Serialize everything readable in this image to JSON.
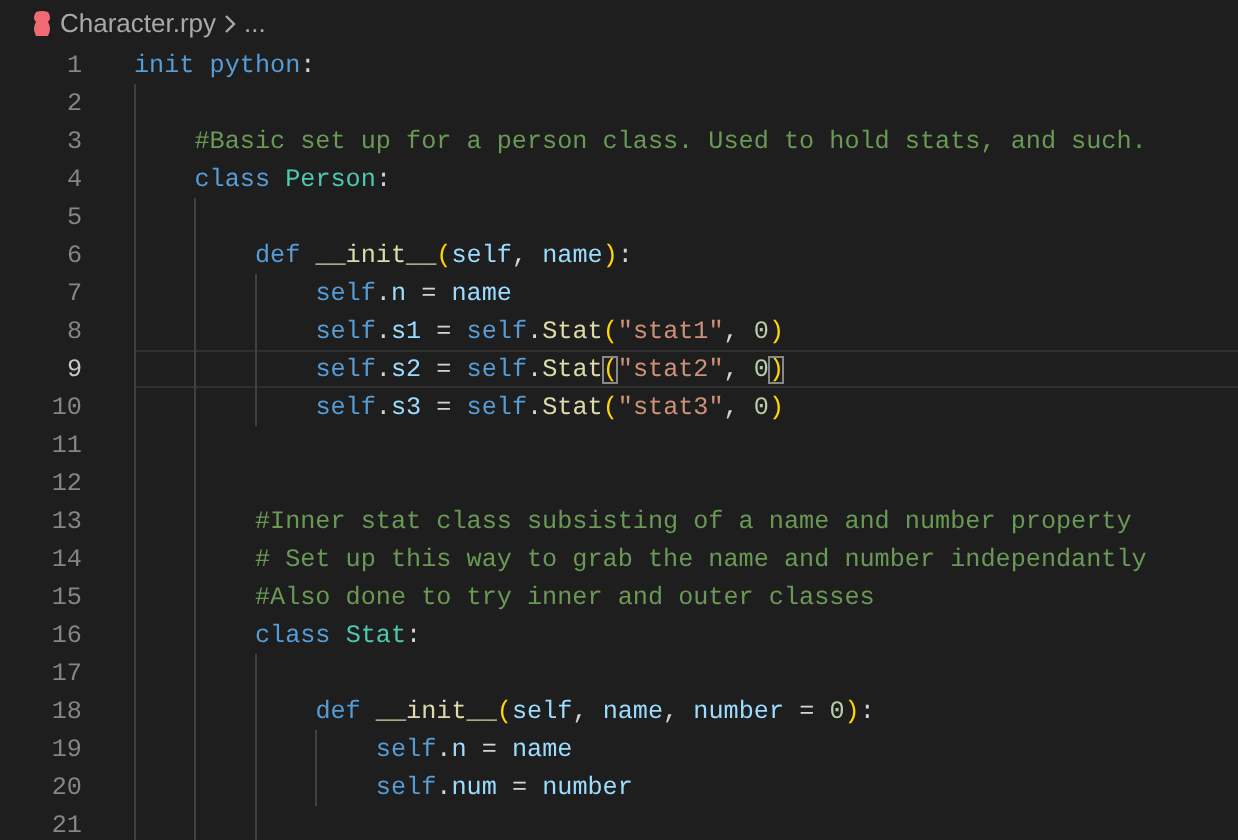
{
  "breadcrumb": {
    "file": "Character.rpy",
    "rest": "..."
  },
  "lines": [
    {
      "number": "1",
      "current": false,
      "tokens": [
        {
          "kind": "keyword",
          "text": "init "
        },
        {
          "kind": "keyword",
          "text": "python"
        },
        {
          "kind": "punct",
          "text": ":"
        }
      ],
      "children": [
        {
          "number": "2",
          "current": false
        },
        {
          "number": "3",
          "current": false,
          "tokens": [
            {
              "kind": "comment",
              "text": "#Basic set up for a person class. Used to hold stats, and such."
            }
          ]
        },
        {
          "number": "4",
          "current": false,
          "tokens": [
            {
              "kind": "keyword",
              "text": "class "
            },
            {
              "kind": "class",
              "text": "Person"
            },
            {
              "kind": "punct",
              "text": ":"
            }
          ],
          "children": [
            {
              "number": "5",
              "current": false
            },
            {
              "number": "6",
              "current": false,
              "tokens": [
                {
                  "kind": "keyword",
                  "text": "def "
                },
                {
                  "kind": "func",
                  "text": "__init__"
                },
                {
                  "kind": "bracket",
                  "text": "("
                },
                {
                  "kind": "param",
                  "text": "self"
                },
                {
                  "kind": "punct",
                  "text": ", "
                },
                {
                  "kind": "param",
                  "text": "name"
                },
                {
                  "kind": "bracket",
                  "text": ")"
                },
                {
                  "kind": "punct",
                  "text": ":"
                }
              ],
              "children": [
                {
                  "number": "7",
                  "current": false,
                  "tokens": [
                    {
                      "kind": "self",
                      "text": "self"
                    },
                    {
                      "kind": "punct",
                      "text": "."
                    },
                    {
                      "kind": "var",
                      "text": "n"
                    },
                    {
                      "kind": "punct",
                      "text": " = "
                    },
                    {
                      "kind": "var",
                      "text": "name"
                    }
                  ]
                },
                {
                  "number": "8",
                  "current": false,
                  "tokens": [
                    {
                      "kind": "self",
                      "text": "self"
                    },
                    {
                      "kind": "punct",
                      "text": "."
                    },
                    {
                      "kind": "var",
                      "text": "s1"
                    },
                    {
                      "kind": "punct",
                      "text": " = "
                    },
                    {
                      "kind": "self",
                      "text": "self"
                    },
                    {
                      "kind": "punct",
                      "text": "."
                    },
                    {
                      "kind": "func",
                      "text": "Stat"
                    },
                    {
                      "kind": "bracket",
                      "text": "("
                    },
                    {
                      "kind": "string",
                      "text": "\"stat1\""
                    },
                    {
                      "kind": "punct",
                      "text": ", "
                    },
                    {
                      "kind": "number",
                      "text": "0"
                    },
                    {
                      "kind": "bracket",
                      "text": ")"
                    }
                  ]
                },
                {
                  "number": "9",
                  "current": true,
                  "tokens": [
                    {
                      "kind": "self",
                      "text": "self"
                    },
                    {
                      "kind": "punct",
                      "text": "."
                    },
                    {
                      "kind": "var",
                      "text": "s2"
                    },
                    {
                      "kind": "punct",
                      "text": " = "
                    },
                    {
                      "kind": "self",
                      "text": "self"
                    },
                    {
                      "kind": "punct",
                      "text": "."
                    },
                    {
                      "kind": "func",
                      "text": "Stat"
                    },
                    {
                      "kind": "matched-bracket",
                      "text": "("
                    },
                    {
                      "kind": "string",
                      "text": "\"stat2\""
                    },
                    {
                      "kind": "punct",
                      "text": ", "
                    },
                    {
                      "kind": "number",
                      "text": "0"
                    },
                    {
                      "kind": "matched-bracket",
                      "text": ")"
                    }
                  ]
                },
                {
                  "number": "10",
                  "current": false,
                  "tokens": [
                    {
                      "kind": "self",
                      "text": "self"
                    },
                    {
                      "kind": "punct",
                      "text": "."
                    },
                    {
                      "kind": "var",
                      "text": "s3"
                    },
                    {
                      "kind": "punct",
                      "text": " = "
                    },
                    {
                      "kind": "self",
                      "text": "self"
                    },
                    {
                      "kind": "punct",
                      "text": "."
                    },
                    {
                      "kind": "func",
                      "text": "Stat"
                    },
                    {
                      "kind": "bracket",
                      "text": "("
                    },
                    {
                      "kind": "string",
                      "text": "\"stat3\""
                    },
                    {
                      "kind": "punct",
                      "text": ", "
                    },
                    {
                      "kind": "number",
                      "text": "0"
                    },
                    {
                      "kind": "bracket",
                      "text": ")"
                    }
                  ]
                }
              ]
            },
            {
              "number": "11",
              "current": false
            },
            {
              "number": "12",
              "current": false
            },
            {
              "number": "13",
              "current": false,
              "tokens": [
                {
                  "kind": "comment",
                  "text": "#Inner stat class subsisting of a name and number property"
                }
              ]
            },
            {
              "number": "14",
              "current": false,
              "tokens": [
                {
                  "kind": "comment",
                  "text": "# Set up this way to grab the name and number independantly"
                }
              ]
            },
            {
              "number": "15",
              "current": false,
              "tokens": [
                {
                  "kind": "comment",
                  "text": "#Also done to try inner and outer classes"
                }
              ]
            },
            {
              "number": "16",
              "current": false,
              "tokens": [
                {
                  "kind": "keyword",
                  "text": "class "
                },
                {
                  "kind": "class",
                  "text": "Stat"
                },
                {
                  "kind": "punct",
                  "text": ":"
                }
              ],
              "children": [
                {
                  "number": "17",
                  "current": false
                },
                {
                  "number": "18",
                  "current": false,
                  "tokens": [
                    {
                      "kind": "keyword",
                      "text": "def "
                    },
                    {
                      "kind": "func",
                      "text": "__init__"
                    },
                    {
                      "kind": "bracket",
                      "text": "("
                    },
                    {
                      "kind": "param",
                      "text": "self"
                    },
                    {
                      "kind": "punct",
                      "text": ", "
                    },
                    {
                      "kind": "param",
                      "text": "name"
                    },
                    {
                      "kind": "punct",
                      "text": ", "
                    },
                    {
                      "kind": "param",
                      "text": "number"
                    },
                    {
                      "kind": "punct",
                      "text": " = "
                    },
                    {
                      "kind": "number",
                      "text": "0"
                    },
                    {
                      "kind": "bracket",
                      "text": ")"
                    },
                    {
                      "kind": "punct",
                      "text": ":"
                    }
                  ],
                  "children": [
                    {
                      "number": "19",
                      "current": false,
                      "tokens": [
                        {
                          "kind": "self",
                          "text": "self"
                        },
                        {
                          "kind": "punct",
                          "text": "."
                        },
                        {
                          "kind": "var",
                          "text": "n"
                        },
                        {
                          "kind": "punct",
                          "text": " = "
                        },
                        {
                          "kind": "var",
                          "text": "name"
                        }
                      ]
                    },
                    {
                      "number": "20",
                      "current": false,
                      "tokens": [
                        {
                          "kind": "self",
                          "text": "self"
                        },
                        {
                          "kind": "punct",
                          "text": "."
                        },
                        {
                          "kind": "var",
                          "text": "num"
                        },
                        {
                          "kind": "punct",
                          "text": " = "
                        },
                        {
                          "kind": "var",
                          "text": "number"
                        }
                      ]
                    }
                  ]
                },
                {
                  "number": "21",
                  "current": false
                }
              ]
            }
          ]
        }
      ]
    }
  ]
}
